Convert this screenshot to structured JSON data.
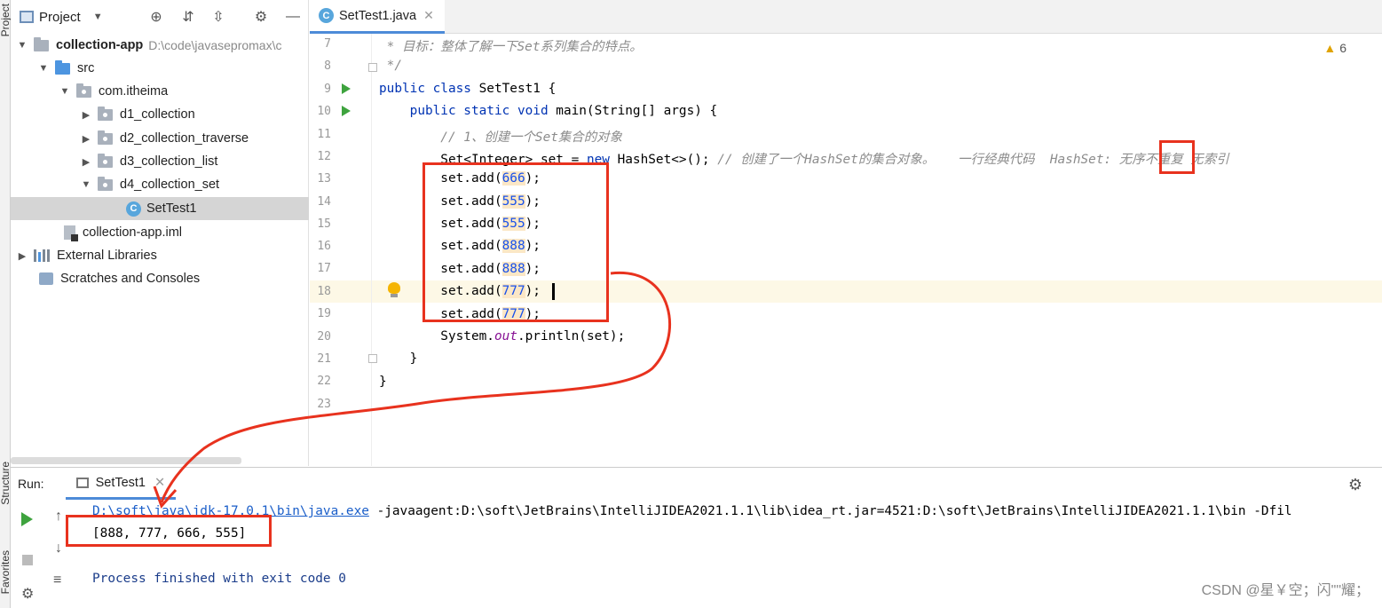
{
  "left_strip": {
    "top_label": "Project",
    "mid_label": "Structure",
    "bottom_label": "Favorites"
  },
  "project": {
    "title": "Project",
    "tree": [
      {
        "label": "collection-app",
        "hint": "D:\\code\\javasepromax\\c"
      },
      {
        "label": "src"
      },
      {
        "label": "com.itheima"
      },
      {
        "label": "d1_collection"
      },
      {
        "label": "d2_collection_traverse"
      },
      {
        "label": "d3_collection_list"
      },
      {
        "label": "d4_collection_set"
      },
      {
        "label": "SetTest1"
      },
      {
        "label": "collection-app.iml"
      },
      {
        "label": "External Libraries"
      },
      {
        "label": "Scratches and Consoles"
      }
    ]
  },
  "editor": {
    "tab": "SetTest1.java",
    "warnings": "6",
    "line_numbers": [
      "7",
      "8",
      "9",
      "10",
      "11",
      "12",
      "13",
      "14",
      "15",
      "16",
      "17",
      "18",
      "19",
      "20",
      "21",
      "22",
      "23"
    ],
    "code": {
      "l7": " * 目标：整体了解一下Set系列集合的特点。",
      "l8": " */",
      "l9_kw": "public class ",
      "l9_rest": "SetTest1 {",
      "l10_kw": "    public static void ",
      "l10_rest": "main(String[] args) {",
      "l11": "        // 1、创建一个Set集合的对象",
      "l12_a": "        Set<Integer> set = ",
      "l12_kw": "new ",
      "l12_b": "HashSet<>(); ",
      "l12_cmt": "// 创建了一个HashSet的集合对象。   一行经典代码  HashSet: 无序不重复 无索引",
      "adds": [
        "666",
        "555",
        "555",
        "888",
        "888",
        "777",
        "777"
      ],
      "add_prefix": "        set.add(",
      "add_suffix": ");",
      "l20_a": "        System.",
      "l20_field": "out",
      "l20_b": ".println(set);",
      "l21": "    }",
      "l22": "}"
    }
  },
  "run": {
    "label": "Run:",
    "tab": "SetTest1",
    "cmd_link": "D:\\soft\\java\\jdk-17.0.1\\bin\\java.exe",
    "cmd_rest": " -javaagent:D:\\soft\\JetBrains\\IntelliJIDEA2021.1.1\\lib\\idea_rt.jar=4521:D:\\soft\\JetBrains\\IntelliJIDEA2021.1.1\\bin -Dfil",
    "output": "[888, 777, 666, 555]",
    "finished": "Process finished with exit code 0"
  },
  "watermark": "CSDN @星￥空；闪\"\"耀；"
}
